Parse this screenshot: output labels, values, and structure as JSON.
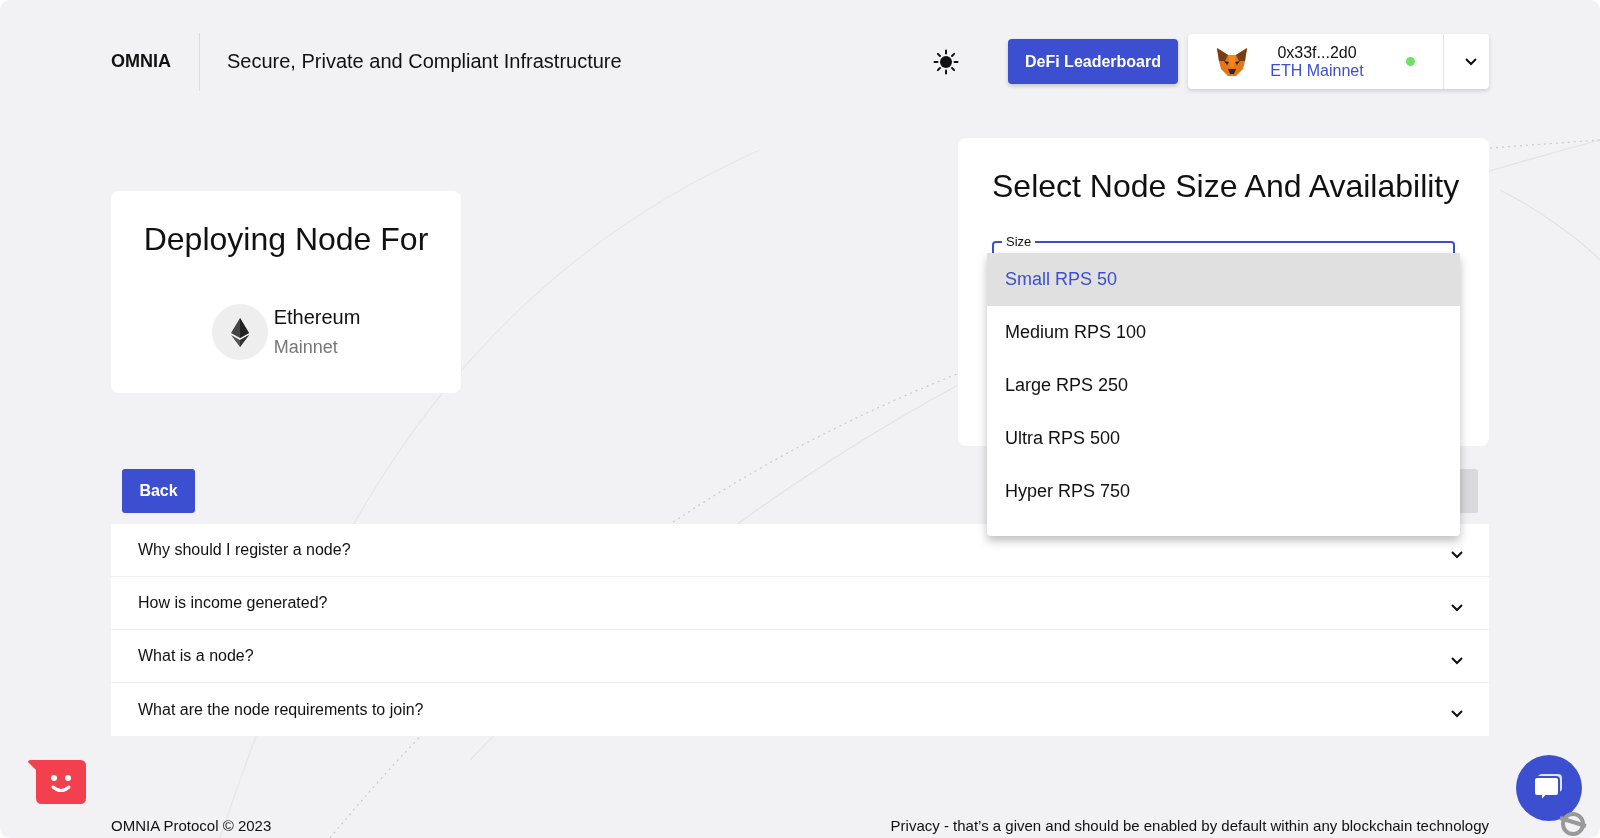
{
  "header": {
    "logo": "OMNIA",
    "tagline": "Secure, Private and Compliant Infrastructure",
    "leaderboard_button": "DeFi Leaderboard",
    "wallet": {
      "address": "0x33f...2d0",
      "network": "ETH Mainnet",
      "connected": true
    }
  },
  "deploy_card": {
    "title": "Deploying Node For",
    "chain": "Ethereum",
    "network": "Mainnet"
  },
  "size_card": {
    "title": "Select Node Size And Availability",
    "field_label": "Size",
    "expanded": true,
    "options": [
      {
        "label": "Small RPS 50",
        "selected": true
      },
      {
        "label": "Medium RPS 100",
        "selected": false
      },
      {
        "label": "Large RPS 250",
        "selected": false
      },
      {
        "label": "Ultra RPS 500",
        "selected": false
      },
      {
        "label": "Hyper RPS 750",
        "selected": false
      }
    ]
  },
  "back_button": "Back",
  "faq": [
    {
      "question": "Why should I register a node?",
      "expanded": false
    },
    {
      "question": "How is income generated?",
      "expanded": false
    },
    {
      "question": "What is a node?",
      "expanded": false
    },
    {
      "question": "What are the node requirements to join?",
      "expanded": false
    }
  ],
  "footer": {
    "copyright": "OMNIA Protocol © 2023",
    "note": "Privacy - that’s a given and should be enabled by default within any blockchain technology"
  }
}
